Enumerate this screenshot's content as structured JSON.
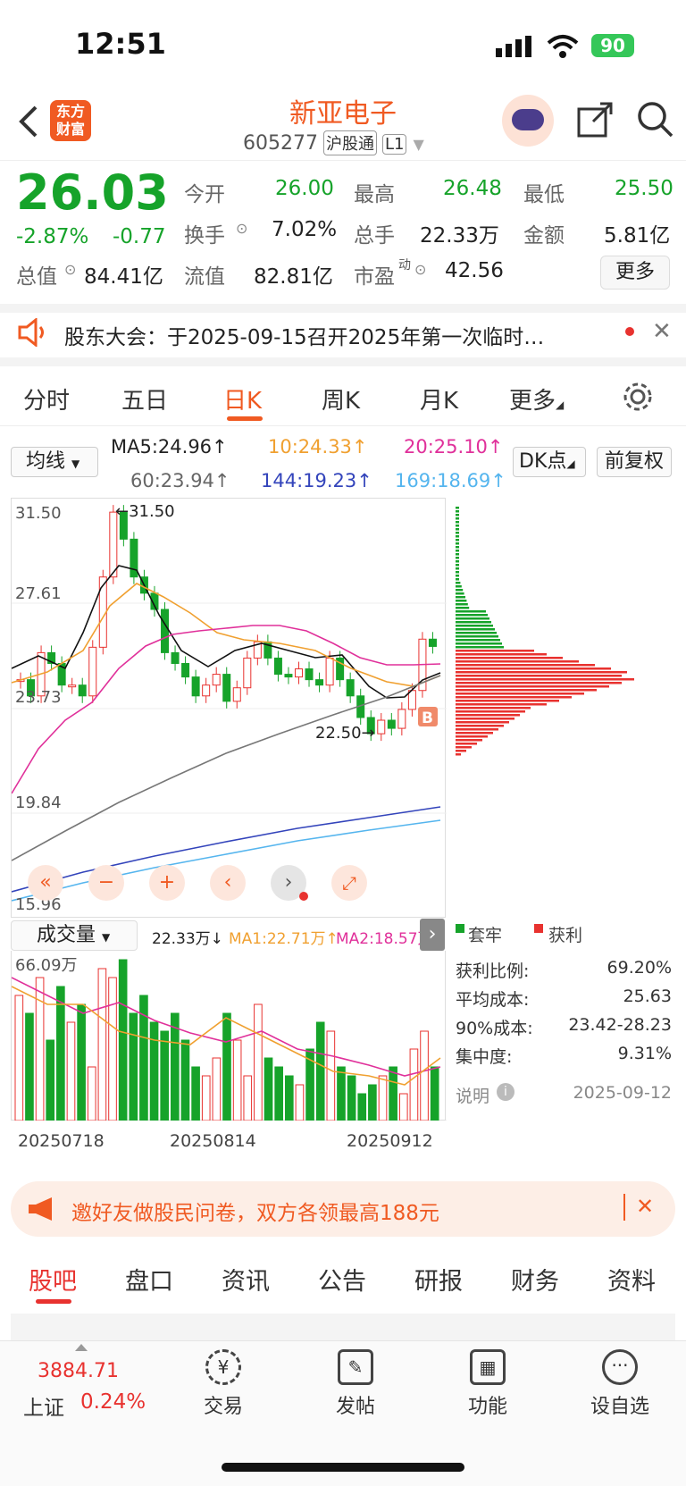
{
  "status": {
    "time": "12:51",
    "battery": "90"
  },
  "header": {
    "logo_text": "东方\n财富",
    "stock_name": "新亚电子",
    "stock_code": "605277",
    "chip1": "沪股通",
    "chip2": "L1"
  },
  "quote": {
    "price": "26.03",
    "pct": "-2.87%",
    "chg": "-0.77",
    "open_label": "今开",
    "open": "26.00",
    "high_label": "最高",
    "high": "26.48",
    "low_label": "最低",
    "low": "25.50",
    "turnover_label": "换手",
    "turnover": "7.02%",
    "vol_label": "总手",
    "vol": "22.33万",
    "amount_label": "金额",
    "amount": "5.81亿",
    "mcap_label": "总值",
    "mcap": "84.41亿",
    "float_label": "流值",
    "float": "82.81亿",
    "pe_label": "市盈",
    "pe_sup": "动",
    "pe": "42.56",
    "more": "更多"
  },
  "notice": {
    "text": "股东大会：于2025-09-15召开2025年第一次临时…"
  },
  "tabs": [
    "分时",
    "五日",
    "日K",
    "周K",
    "月K",
    "更多"
  ],
  "active_tab": "日K",
  "chart_controls": {
    "ma_select": "均线",
    "dk": "DK点",
    "fq": "前复权",
    "ma5": "MA5:24.96↑",
    "ma10": "10:24.33↑",
    "ma20": "20:25.10↑",
    "ma60": "60:23.94↑",
    "ma144": "144:19.23↑",
    "ma169": "169:18.69↑"
  },
  "chart_labels": {
    "y_top": "31.50",
    "y2": "27.61",
    "y3": "23.73",
    "y4": "19.84",
    "y_bottom": "15.96",
    "max_mark": "←31.50",
    "min_mark": "22.50→",
    "b_mark": "B"
  },
  "volume": {
    "select": "成交量",
    "value": "22.33万↓",
    "ma1": "MA1:22.71万↑",
    "ma2": "MA2:18.57万",
    "top": "66.09万",
    "dates": [
      "20250718",
      "20250814",
      "20250912"
    ]
  },
  "chips": {
    "legend_trap": "套牢",
    "legend_profit": "获利",
    "rows": [
      {
        "label": "获利比例:",
        "value": "69.20%"
      },
      {
        "label": "平均成本:",
        "value": "25.63"
      },
      {
        "label": "90%成本:",
        "value": "23.42-28.23"
      },
      {
        "label": "集中度:",
        "value": "9.31%"
      }
    ],
    "note_label": "说明",
    "date": "2025-09-12"
  },
  "banner": {
    "text": "邀好友做股民问卷，双方各领最高188元"
  },
  "bottom_tabs": [
    "股吧",
    "盘口",
    "资讯",
    "公告",
    "研报",
    "财务",
    "资料"
  ],
  "dock": {
    "index_value": "3884.71",
    "index_name": "上证",
    "index_pct": "0.24%",
    "items": [
      "交易",
      "发帖",
      "功能",
      "设自选"
    ]
  },
  "colors": {
    "up": "#e8322f",
    "down": "#16a32a",
    "brand": "#f05a22"
  },
  "chart_data": {
    "type": "candlestick",
    "ylim": [
      15.96,
      31.5
    ],
    "yticks": [
      31.5,
      27.61,
      23.73,
      19.84,
      15.96
    ],
    "closes": [
      24.8,
      24.2,
      25.8,
      25.4,
      24.6,
      24.6,
      24.2,
      26.0,
      28.6,
      31.0,
      30.0,
      28.6,
      28.0,
      27.4,
      25.8,
      25.4,
      24.9,
      24.2,
      24.6,
      25.0,
      24.0,
      24.5,
      25.6,
      26.2,
      25.6,
      25.0,
      24.9,
      25.2,
      24.8,
      24.6,
      25.6,
      24.8,
      24.2,
      23.4,
      22.8,
      23.3,
      23.0,
      23.7,
      24.4,
      26.3,
      26.03
    ],
    "max": 31.5,
    "min": 22.5
  }
}
